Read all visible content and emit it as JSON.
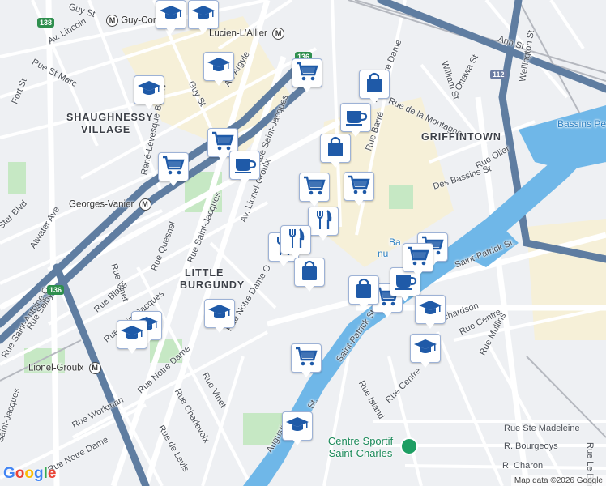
{
  "colors": {
    "water": "#6fb7e8",
    "park": "#c6e8c4",
    "highway": "#5f7da1",
    "road": "#ffffff",
    "commercial": "#f6f0d8",
    "rail": "#b5b8bf",
    "marker_icon": "#1f5aa8"
  },
  "streets": [
    "Guy St",
    "Av. Lincoln",
    "Rue St Marc",
    "Fort St",
    "Av. Argyle",
    "Guy St",
    "Rue Saint-Jacques",
    "Ann St",
    "Rue Notre Dame",
    "William St",
    "Ottawa St",
    "Rue de la Montagne",
    "Rue Barré",
    "Wellington St",
    "René-Lévesque Blvd W",
    "Des Bassins St",
    "Rue Olier",
    "Av. Lionel-Groulx",
    "Rue Saint-Jacques",
    "Rue Quesnel",
    "Ster Blvd",
    "Atwater Ave",
    "Rue Vinet",
    "Rue Saint-Jacques",
    "Rue Blake",
    "Rue Saint-Antoine O",
    "Rue Selby",
    "Rue Notre Dame O",
    "Saint-Patrick St.",
    "Saint-Patrick St.",
    "Rue Centre",
    "Rue Centre",
    "Rue Notre Dame",
    "Rue Vinet",
    "Rue Charlevoix",
    "Rue Workman",
    "Rue de Lévis",
    "Rue Island",
    "Rue Mullins",
    "Rue Ste Madeleine",
    "R. Bourgeoys",
    "R. Charon",
    "Augustin",
    "St.",
    "Rue Notre Dame",
    "Saint-Jacques",
    "Rue Le Ber",
    "Richardson"
  ],
  "areas": [
    "SHAUGHNESSY",
    "VILLAGE",
    "GRIFFINTOWN",
    "LITTLE",
    "BURGUNDY"
  ],
  "stations": [
    "Guy-Concordia",
    "Lucien-L'Allier",
    "Georges-Vanier",
    "Lionel-Groulx"
  ],
  "station_marks": [
    "M",
    "M",
    "M",
    "M"
  ],
  "water_labels": [
    "Bassins Pe",
    "Ba",
    "nu"
  ],
  "park_label": "Centre Sportif Saint-Charles",
  "shields": [
    "138",
    "136",
    "112",
    "136"
  ],
  "markers": [
    {
      "icon": "graduation-cap-icon"
    },
    {
      "icon": "graduation-cap-icon"
    },
    {
      "icon": "graduation-cap-icon"
    },
    {
      "icon": "graduation-cap-icon"
    },
    {
      "icon": "shopping-cart-icon"
    },
    {
      "icon": "shopping-bag-icon"
    },
    {
      "icon": "coffee-cup-icon"
    },
    {
      "icon": "shopping-cart-icon"
    },
    {
      "icon": "shopping-cart-icon"
    },
    {
      "icon": "coffee-cup-icon"
    },
    {
      "icon": "shopping-bag-icon"
    },
    {
      "icon": "shopping-cart-icon"
    },
    {
      "icon": "shopping-cart-icon"
    },
    {
      "icon": "fork-knife-icon"
    },
    {
      "icon": "fork-knife-icon"
    },
    {
      "icon": "fork-knife-icon"
    },
    {
      "icon": "shopping-bag-icon"
    },
    {
      "icon": "graduation-cap-icon"
    },
    {
      "icon": "graduation-cap-icon"
    },
    {
      "icon": "graduation-cap-icon"
    },
    {
      "icon": "shopping-cart-icon"
    },
    {
      "icon": "shopping-cart-icon"
    },
    {
      "icon": "coffee-cup-icon"
    },
    {
      "icon": "shopping-bag-icon"
    },
    {
      "icon": "shopping-cart-icon"
    },
    {
      "icon": "graduation-cap-icon"
    },
    {
      "icon": "graduation-cap-icon"
    },
    {
      "icon": "shopping-cart-icon"
    },
    {
      "icon": "graduation-cap-icon"
    }
  ],
  "branding": {
    "logo_letters": [
      "G",
      "o",
      "o",
      "g",
      "l",
      "e"
    ],
    "attribution": "Map data ©2026 Google"
  }
}
